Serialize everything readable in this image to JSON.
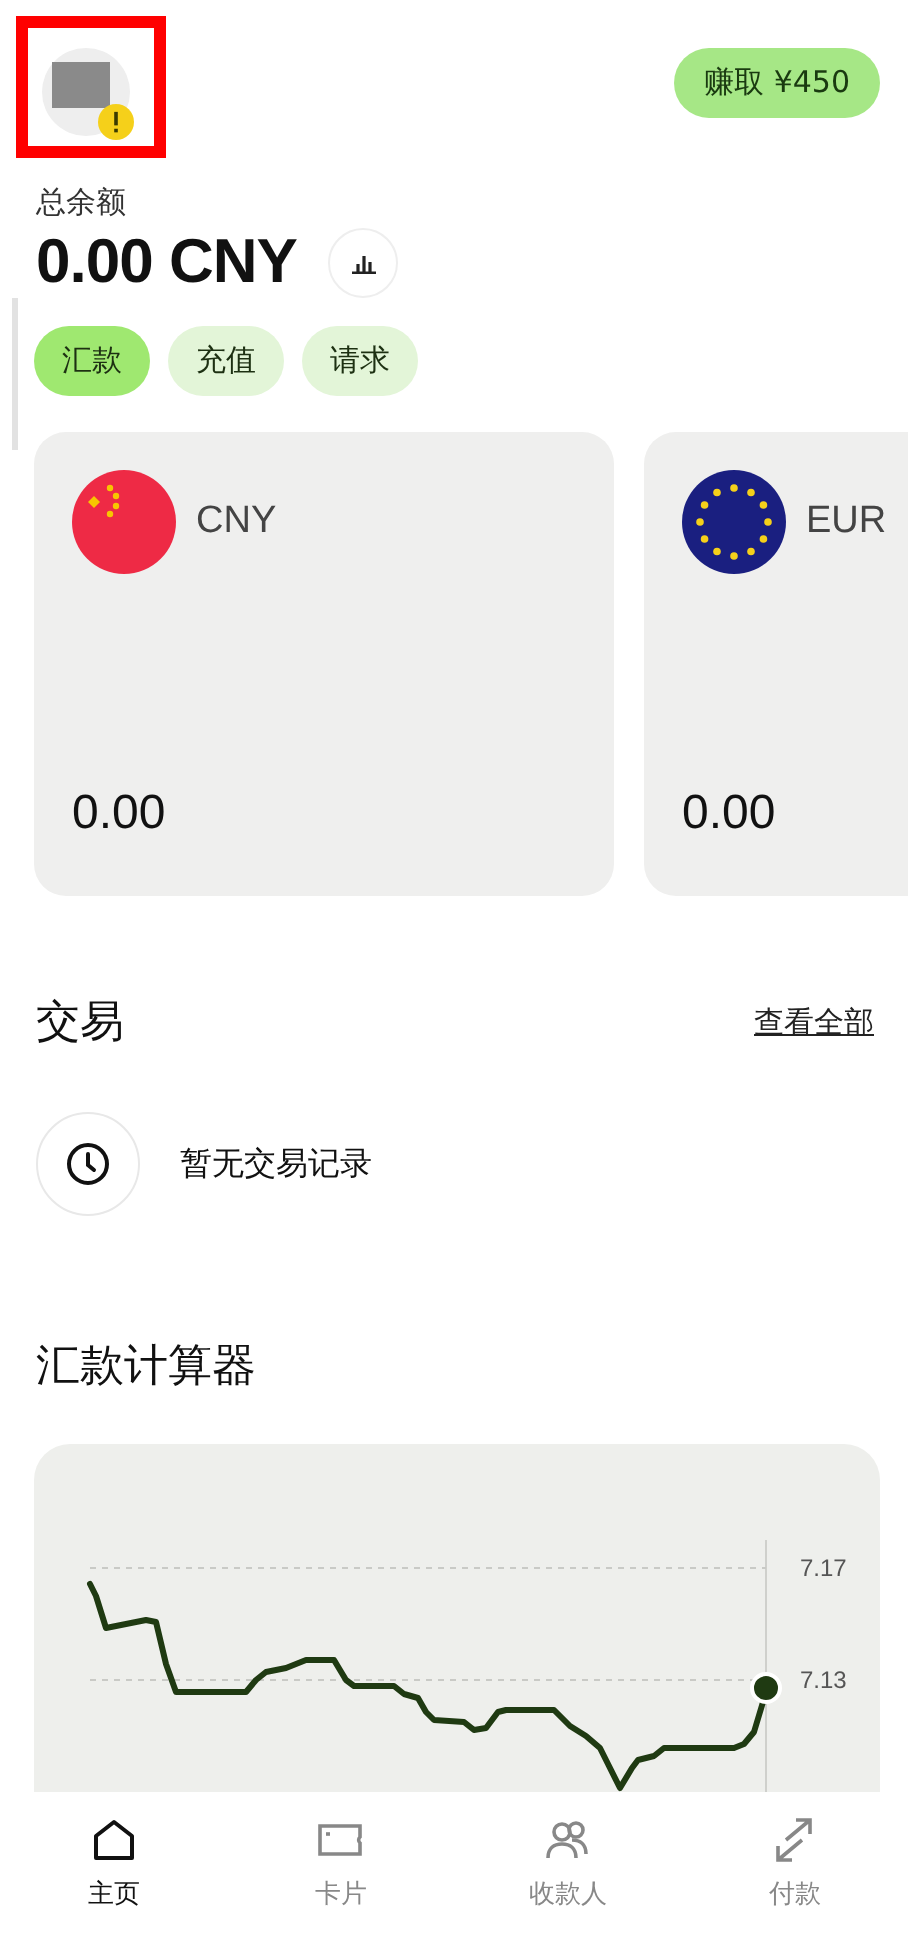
{
  "header": {
    "avatar": {
      "warning": true,
      "highlighted": true
    },
    "earn_button": "赚取 ¥450"
  },
  "balance": {
    "label": "总余额",
    "amount": "0.00 CNY"
  },
  "actions": [
    {
      "label": "汇款",
      "selected": true
    },
    {
      "label": "充值",
      "selected": false
    },
    {
      "label": "请求",
      "selected": false
    }
  ],
  "accounts": [
    {
      "currency": "CNY",
      "kind": "cny",
      "amount": "0.00"
    },
    {
      "currency": "EUR",
      "kind": "eur",
      "amount": "0.00"
    }
  ],
  "transactions": {
    "title": "交易",
    "view_all": "查看全部",
    "empty_text": "暂无交易记录"
  },
  "calculator": {
    "title": "汇款计算器",
    "rate_labels": [
      "7.17",
      "7.13"
    ]
  },
  "nav": [
    {
      "label": "主页",
      "kind": "home",
      "selected": true
    },
    {
      "label": "卡片",
      "kind": "card",
      "selected": false
    },
    {
      "label": "收款人",
      "kind": "people",
      "selected": false
    },
    {
      "label": "付款",
      "kind": "transfer",
      "selected": false
    }
  ]
}
